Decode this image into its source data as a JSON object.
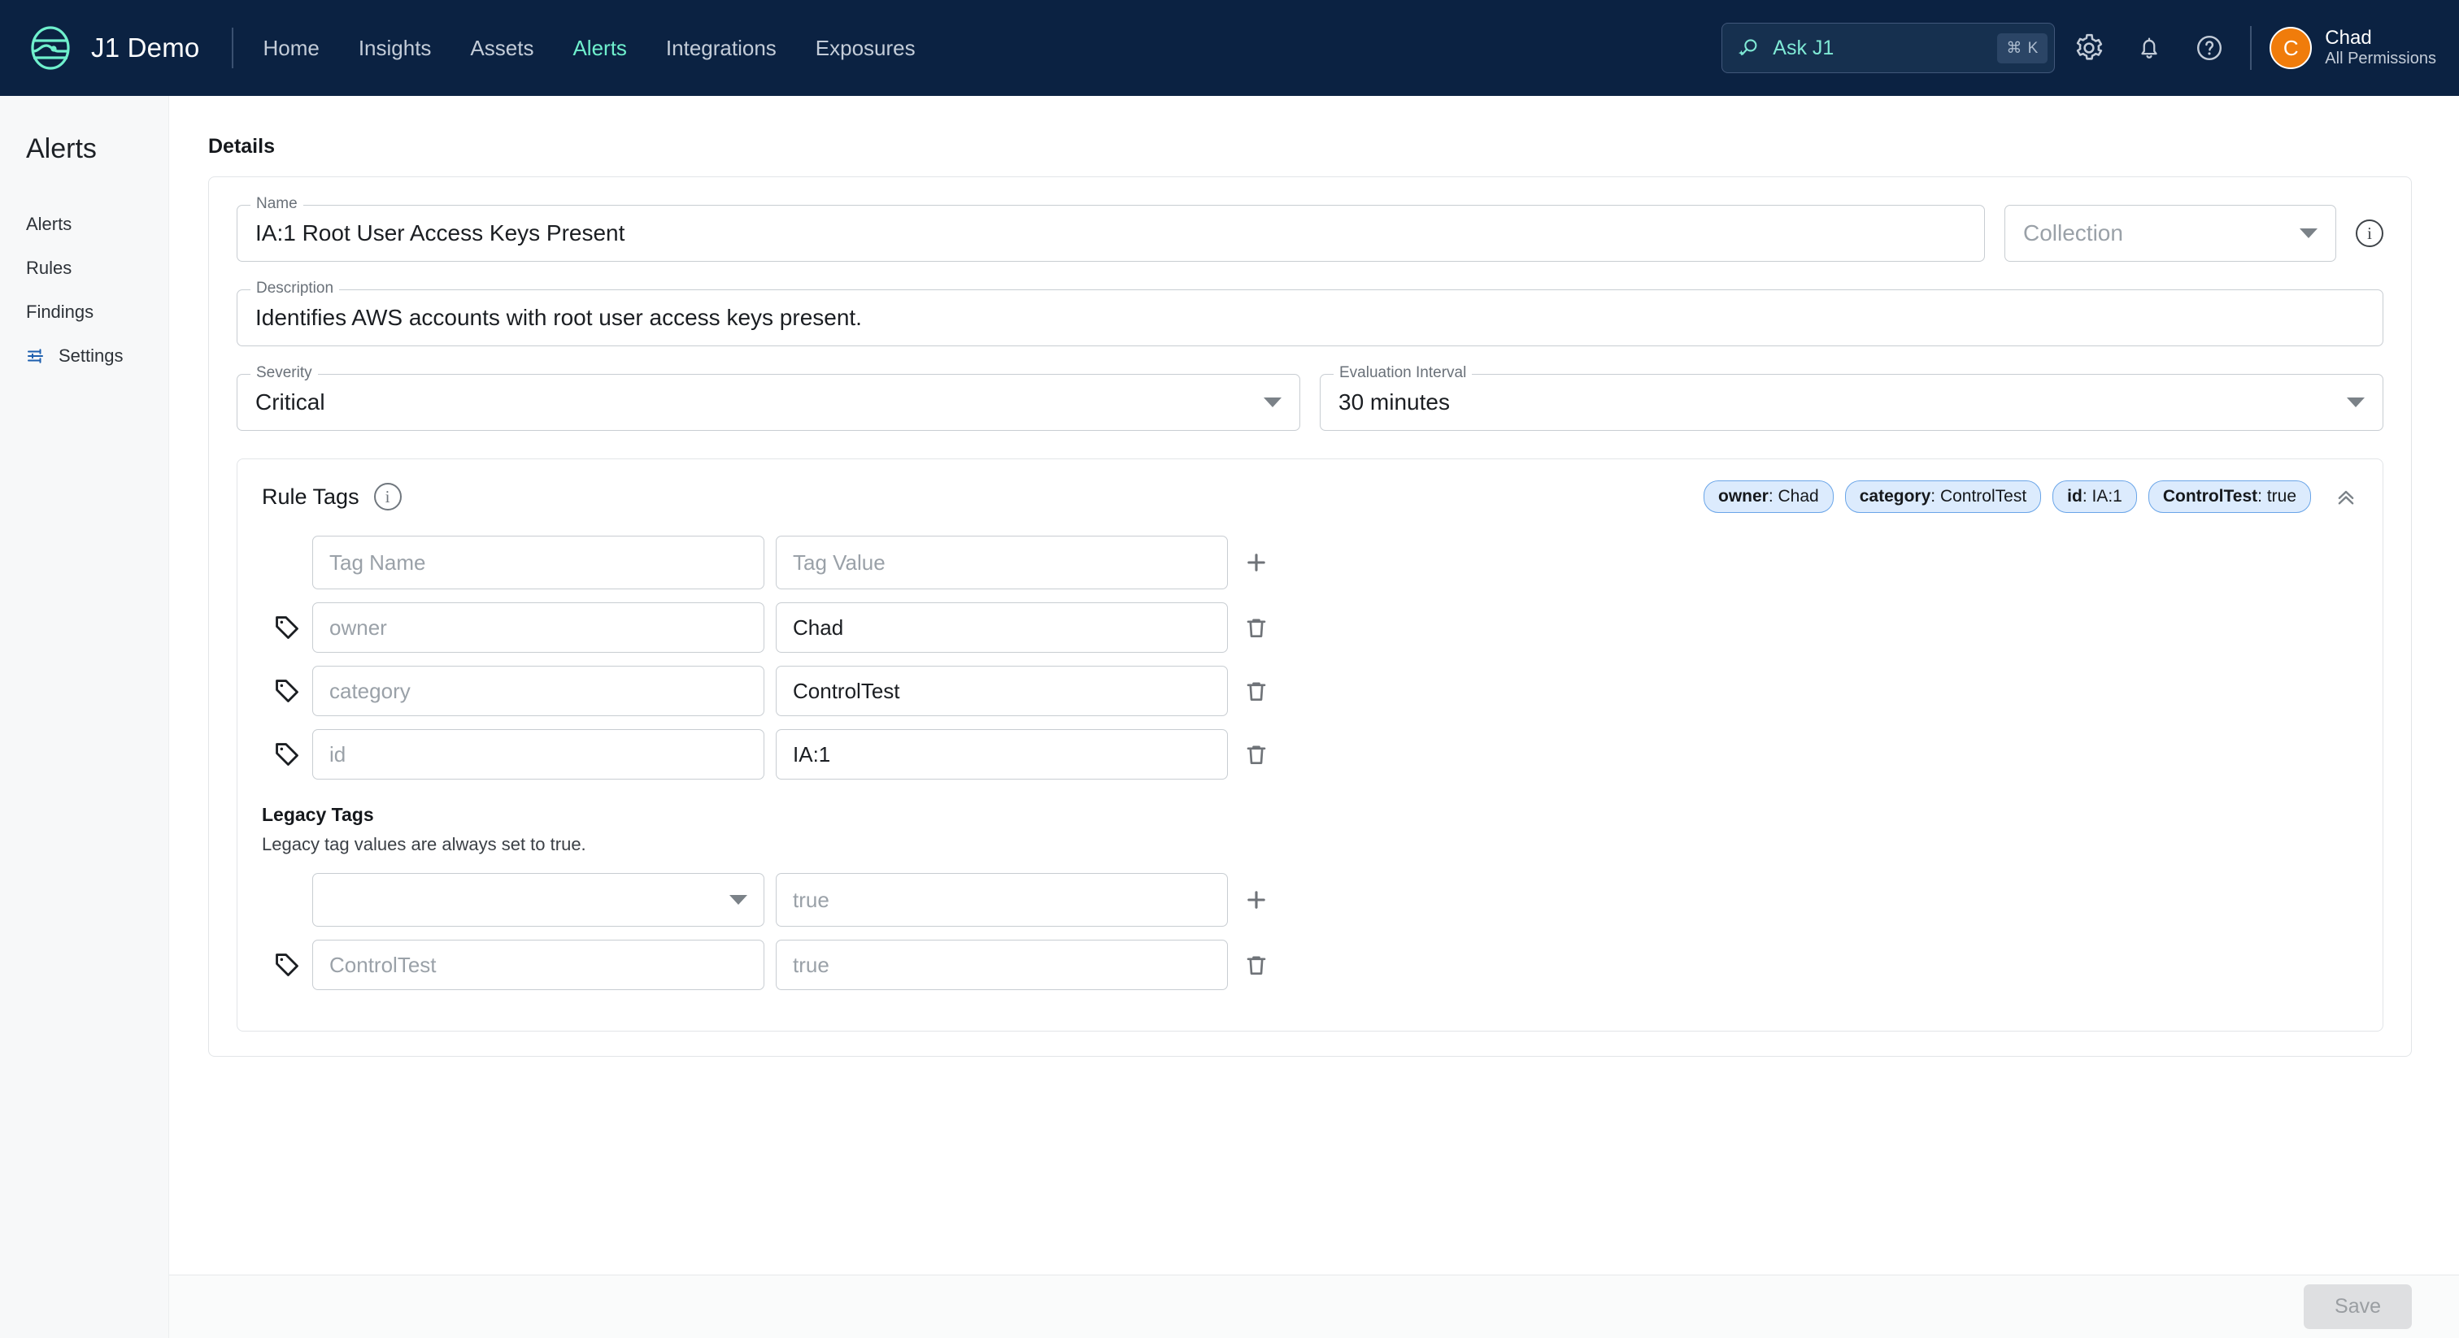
{
  "header": {
    "brand": "J1 Demo",
    "nav": [
      {
        "label": "Home",
        "active": false
      },
      {
        "label": "Insights",
        "active": false
      },
      {
        "label": "Assets",
        "active": false
      },
      {
        "label": "Alerts",
        "active": true
      },
      {
        "label": "Integrations",
        "active": false
      },
      {
        "label": "Exposures",
        "active": false
      }
    ],
    "ask": {
      "label": "Ask J1",
      "shortcut": "⌘ K"
    },
    "user": {
      "initial": "C",
      "name": "Chad",
      "role": "All Permissions"
    },
    "accent": "#6ff0cd",
    "background": "#0b2242"
  },
  "sidebar": {
    "title": "Alerts",
    "items": [
      {
        "label": "Alerts",
        "icon": ""
      },
      {
        "label": "Rules",
        "icon": ""
      },
      {
        "label": "Findings",
        "icon": ""
      },
      {
        "label": "Settings",
        "icon": "sliders-icon"
      }
    ]
  },
  "main": {
    "section_title": "Details",
    "name": {
      "label": "Name",
      "value": "IA:1 Root User Access Keys Present"
    },
    "collection": {
      "placeholder": "Collection",
      "value": ""
    },
    "description": {
      "label": "Description",
      "value": "Identifies AWS accounts with root user access keys present."
    },
    "severity": {
      "label": "Severity",
      "value": "Critical"
    },
    "evaluation_interval": {
      "label": "Evaluation Interval",
      "value": "30 minutes"
    },
    "rule_tags": {
      "title": "Rule Tags",
      "chips": [
        {
          "key": "owner",
          "value": "Chad"
        },
        {
          "key": "category",
          "value": "ControlTest"
        },
        {
          "key": "id",
          "value": "IA:1"
        },
        {
          "key": "ControlTest",
          "value": "true"
        }
      ],
      "new_row": {
        "name_placeholder": "Tag Name",
        "value_placeholder": "Tag Value"
      },
      "rows": [
        {
          "name": "owner",
          "value": "Chad"
        },
        {
          "name": "category",
          "value": "ControlTest"
        },
        {
          "name": "id",
          "value": "IA:1"
        }
      ]
    },
    "legacy_tags": {
      "title": "Legacy Tags",
      "subtitle": "Legacy tag values are always set to true.",
      "new_row": {
        "name": "",
        "value_placeholder": "true"
      },
      "rows": [
        {
          "name": "ControlTest",
          "value": "true"
        }
      ]
    }
  },
  "footer": {
    "save_label": "Save"
  }
}
